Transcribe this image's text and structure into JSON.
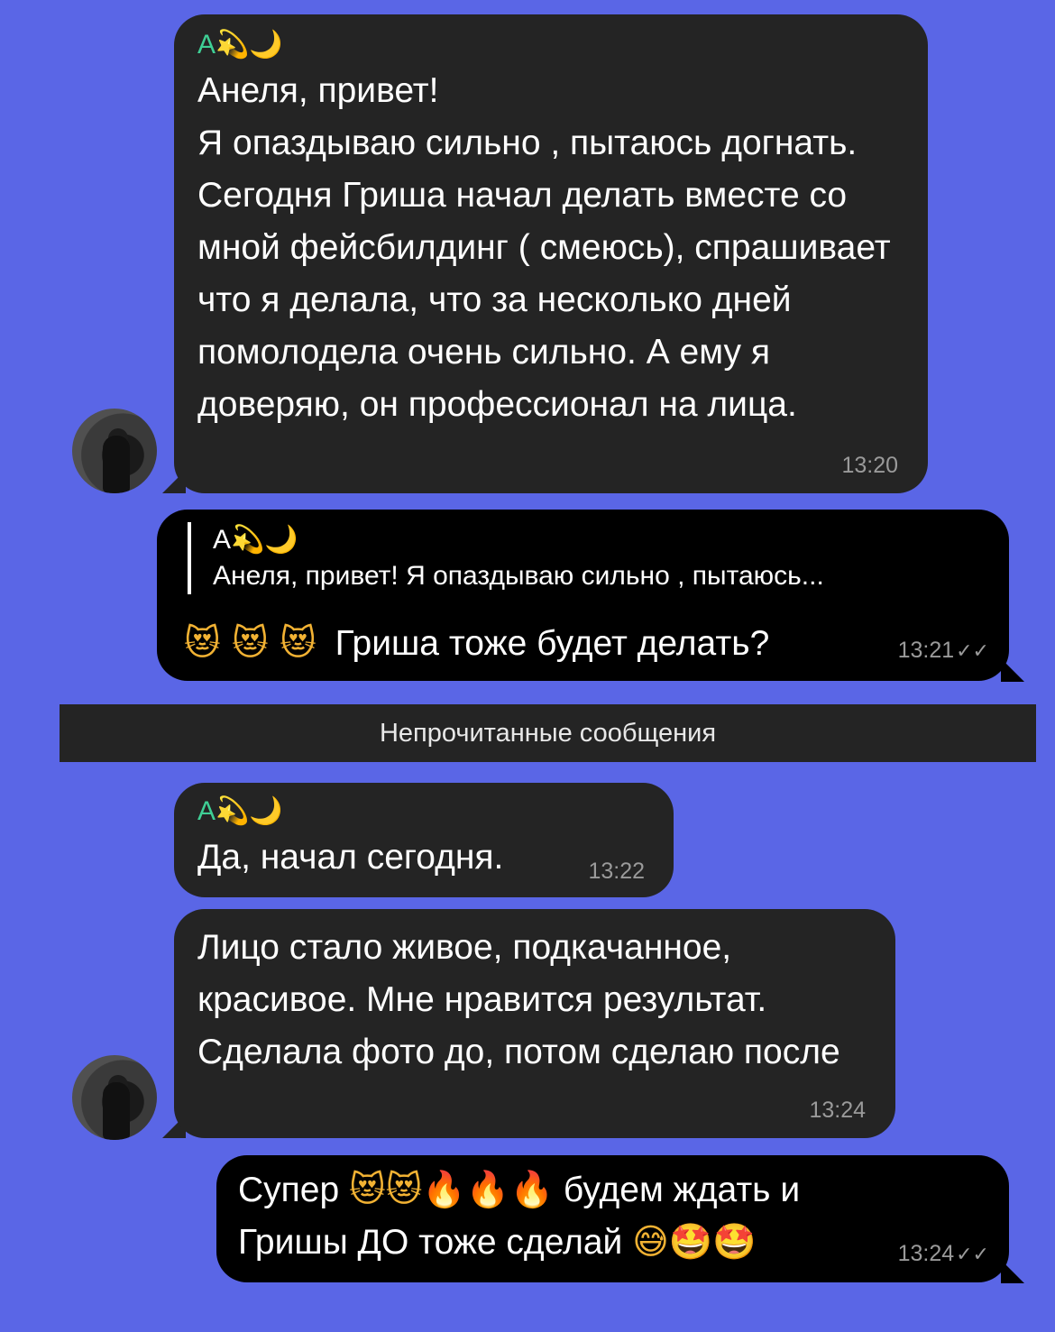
{
  "chat": {
    "messages": [
      {
        "id": "m1",
        "direction": "incoming",
        "sender": "А",
        "sender_symbols": "💫🌙",
        "text": "Анеля, привет!\nЯ опаздываю сильно , пытаюсь догнать. Сегодня Гриша начал делать вместе со мной фейсбилдинг ( смеюсь), спрашивает что я делала, что за несколько дней помолодела очень сильно. А ему я доверяю, он профессионал на лица.",
        "time": "13:20"
      },
      {
        "id": "m2",
        "direction": "outgoing",
        "reply_to": {
          "sender": "А",
          "sender_symbols": "💫🌙",
          "text": "Анеля, привет!  Я опаздываю сильно , пытаюсь..."
        },
        "emojis": "😻 😻 😻",
        "text": "Гриша тоже будет делать?",
        "time": "13:21",
        "status": "✓✓"
      },
      {
        "id": "m3",
        "direction": "incoming",
        "sender": "А",
        "sender_symbols": "💫🌙",
        "text": "Да, начал сегодня.",
        "time": "13:22"
      },
      {
        "id": "m4",
        "direction": "incoming",
        "text": "Лицо стало живое, подкачанное, красивое. Мне нравится результат. Сделала фото до, потом сделаю после",
        "time": "13:24"
      },
      {
        "id": "m5",
        "direction": "outgoing",
        "line1_prefix": "Супер",
        "line1_emojis": "😻😻🔥🔥🔥",
        "line1_suffix": "будем ждать и",
        "line2_text": "Гришы ДО тоже сделай",
        "line2_emojis": "😅🤩🤩",
        "time": "13:24",
        "status": "✓✓"
      }
    ],
    "unread_divider": "Непрочитанные сообщения"
  },
  "colors": {
    "background": "#5a66e6",
    "incoming_bubble": "#242424",
    "outgoing_bubble": "#000000",
    "sender_name": "#3fcf95"
  }
}
